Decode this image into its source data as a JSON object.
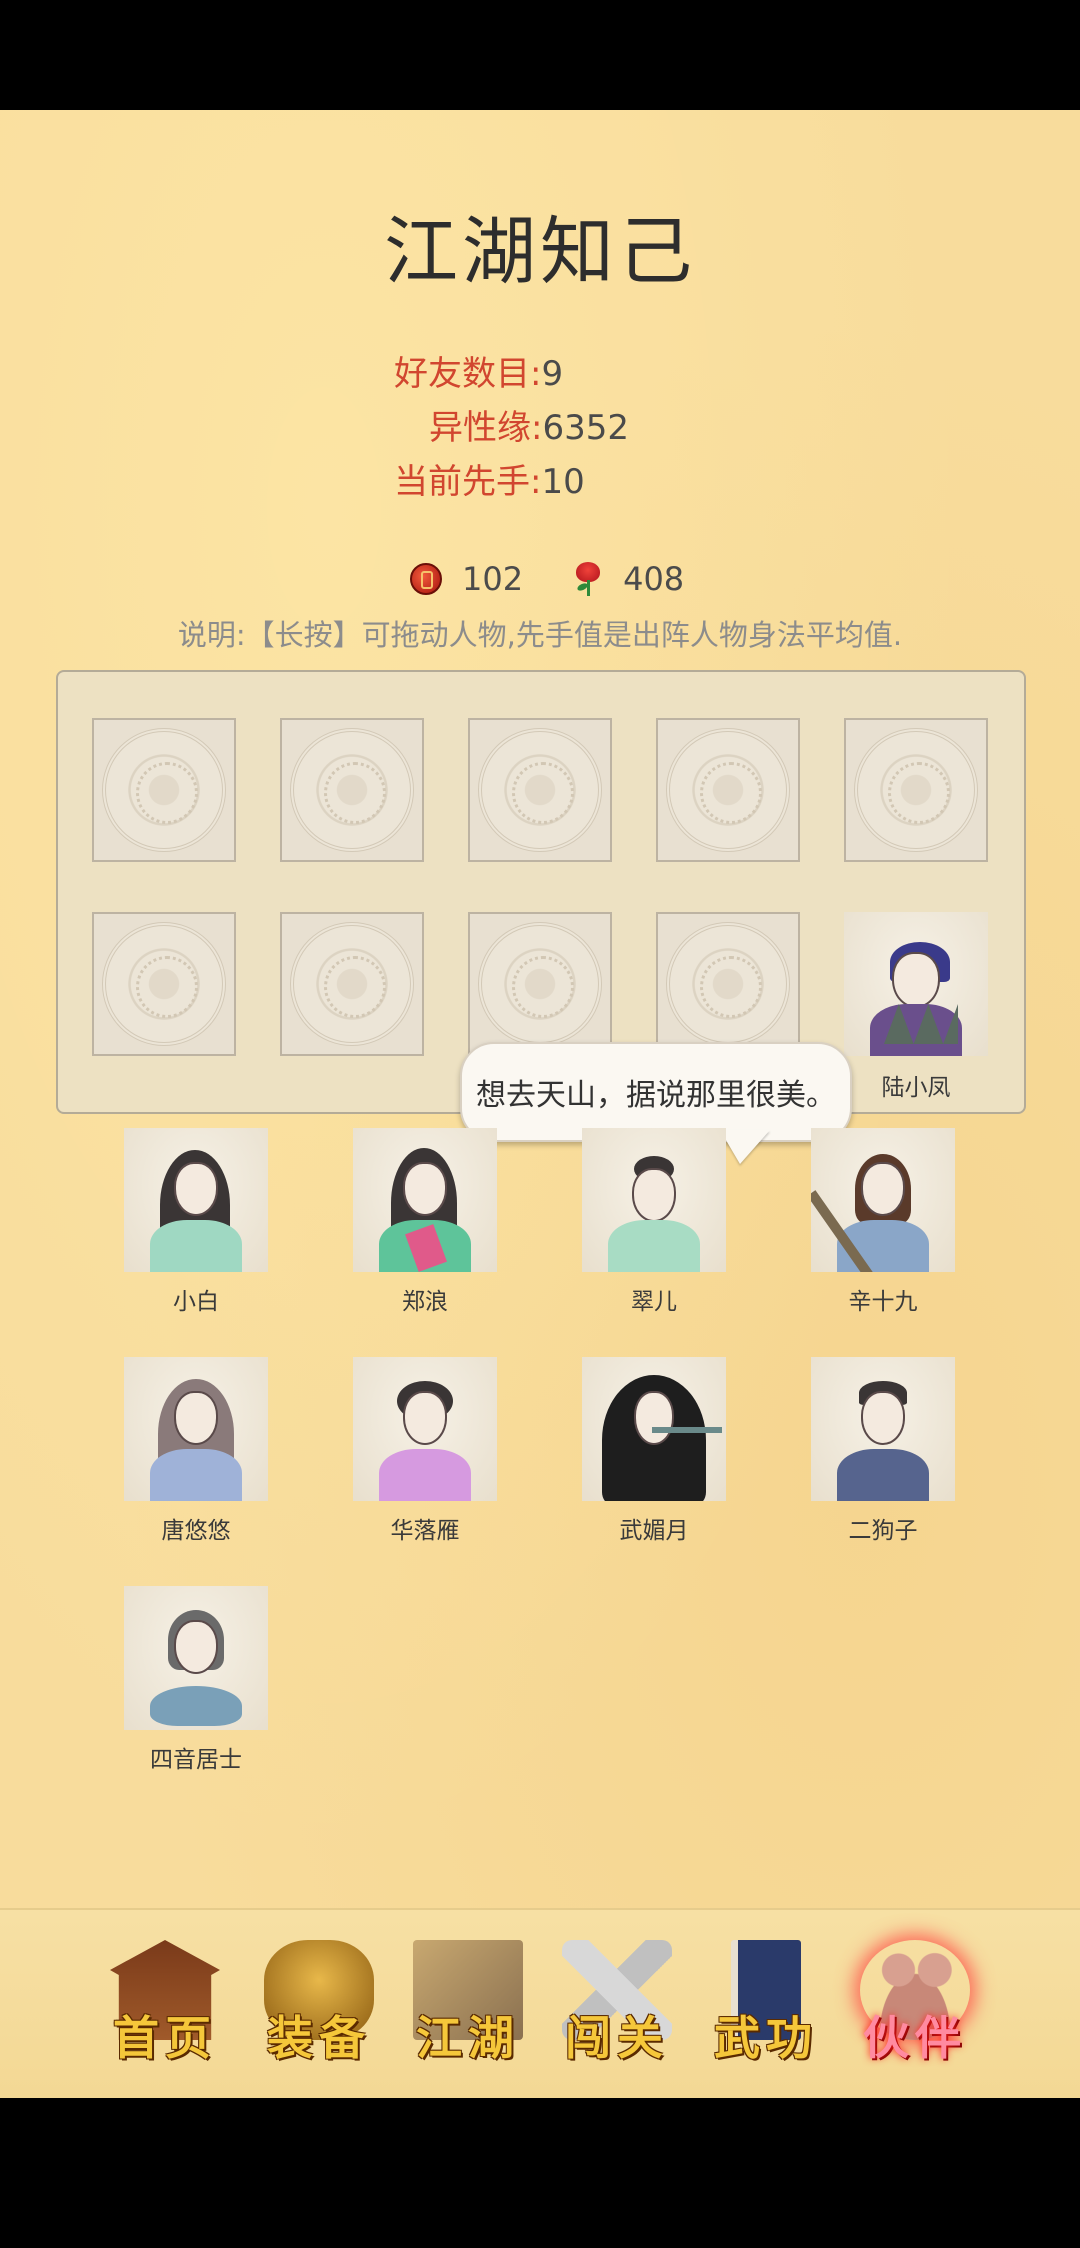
{
  "page": {
    "title": "江湖知己"
  },
  "stats": [
    {
      "label": "好友数目:",
      "value": "9"
    },
    {
      "label": "异性缘:",
      "value": "6352"
    },
    {
      "label": "当前先手:",
      "value": "10"
    }
  ],
  "currency": {
    "coins": "102",
    "roses": "408"
  },
  "note": "说明:【长按】可拖动人物,先手值是出阵人物身法平均值.",
  "formation": {
    "active_member": "陆小凤"
  },
  "speech_bubble": "想去天山，据说那里很美。",
  "roster": [
    {
      "name": "小白"
    },
    {
      "name": "郑浪"
    },
    {
      "name": "翠儿"
    },
    {
      "name": "辛十九"
    },
    {
      "name": "唐悠悠"
    },
    {
      "name": "华落雁"
    },
    {
      "name": "武媚月"
    },
    {
      "name": "二狗子"
    },
    {
      "name": "四音居士"
    }
  ],
  "tabs": [
    {
      "label": "首页",
      "icon": "temple-icon"
    },
    {
      "label": "装备",
      "icon": "armor-icon"
    },
    {
      "label": "江湖",
      "icon": "scroll-map-icon"
    },
    {
      "label": "闯关",
      "icon": "crossed-swords-icon"
    },
    {
      "label": "武功",
      "icon": "martial-book-icon"
    },
    {
      "label": "伙伴",
      "icon": "companions-icon",
      "active": true
    }
  ]
}
